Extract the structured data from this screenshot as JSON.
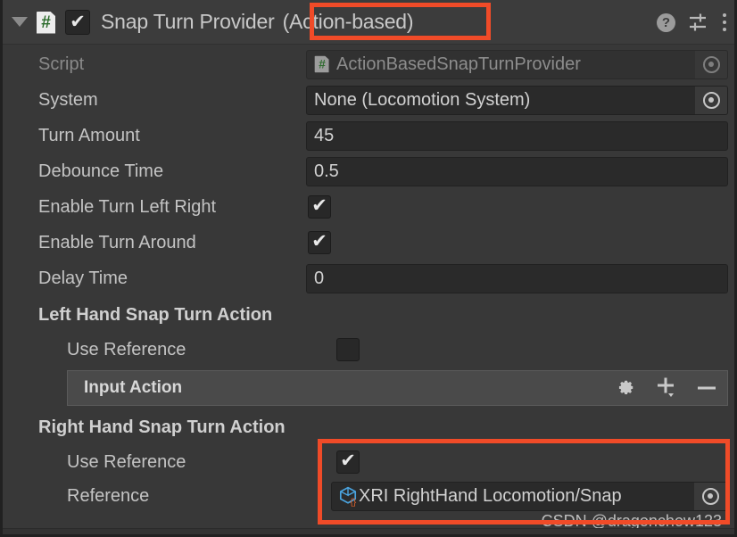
{
  "component": {
    "title": "Snap Turn Provider",
    "subtitle": "(Action-based)",
    "enabled": true,
    "foldout_expanded": true,
    "icons": {
      "foldout": "triangle-down-icon",
      "script": "csharp-script-icon",
      "hash": "#",
      "enabled_check": "✔",
      "help": "?",
      "preset": "preset-sliders-icon",
      "menu": "kebab-menu-icon"
    }
  },
  "properties": [
    {
      "label": "Script",
      "type": "object",
      "value": "ActionBasedSnapTurnProvider",
      "disabled": true,
      "icon": "csharp-script-icon",
      "picker": "object-picker-icon"
    },
    {
      "label": "System",
      "type": "object",
      "value": "None (Locomotion System)",
      "disabled": false,
      "picker": "object-picker-icon"
    },
    {
      "label": "Turn Amount",
      "type": "number",
      "value": "45"
    },
    {
      "label": "Debounce Time",
      "type": "number",
      "value": "0.5"
    },
    {
      "label": "Enable Turn Left Right",
      "type": "toggle",
      "checked": true
    },
    {
      "label": "Enable Turn Around",
      "type": "toggle",
      "checked": true
    },
    {
      "label": "Delay Time",
      "type": "number",
      "value": "0"
    }
  ],
  "left_hand_section": {
    "header": "Left Hand Snap Turn Action",
    "use_reference_label": "Use Reference",
    "use_reference_checked": false,
    "input_action_label": "Input Action",
    "tools": {
      "gear": "gear-icon",
      "add": "plus-dropdown-icon",
      "remove": "minus-icon"
    }
  },
  "right_hand_section": {
    "header": "Right Hand Snap Turn Action",
    "use_reference_label": "Use Reference",
    "use_reference_checked": true,
    "reference_label": "Reference",
    "reference_value": "XRI RightHand Locomotion/Snap",
    "reference_icon": "input-action-asset-icon",
    "picker": "object-picker-icon"
  },
  "watermark": "CSDN @dragonchow123",
  "annotations": {
    "highlight_color": "#F04B28",
    "boxes": [
      {
        "name": "subtitle-highlight"
      },
      {
        "name": "right-hand-reference-highlight"
      }
    ]
  }
}
